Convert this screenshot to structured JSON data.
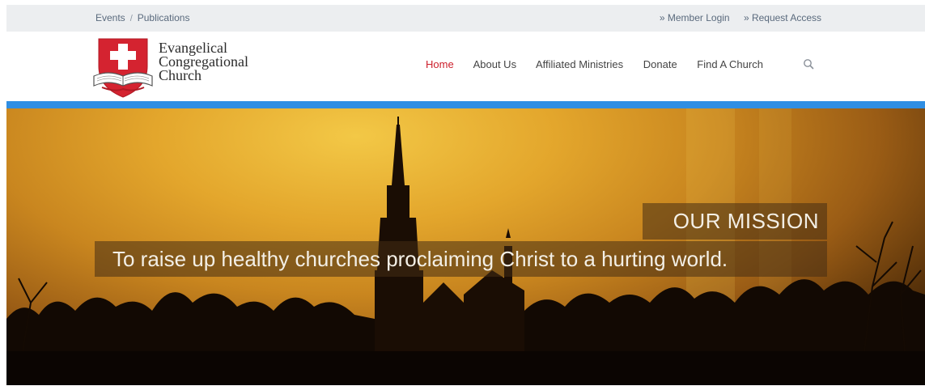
{
  "topbar": {
    "crumbs": [
      "Events",
      "Publications"
    ],
    "crumb_separator": "/",
    "member_login": "» Member Login",
    "request_access": "» Request Access"
  },
  "logo": {
    "line1": "Evangelical",
    "line2": "Congregational",
    "line3": "Church"
  },
  "nav": {
    "items": [
      {
        "label": "Home",
        "active": true
      },
      {
        "label": "About Us",
        "active": false
      },
      {
        "label": "Affiliated Ministries",
        "active": false
      },
      {
        "label": "Donate",
        "active": false
      },
      {
        "label": "Find A Church",
        "active": false
      }
    ],
    "search_icon": "search-icon"
  },
  "hero": {
    "label": "OUR MISSION",
    "statement": "To raise up healthy churches proclaiming Christ to a hurting world."
  },
  "colors": {
    "accent_blue": "#2f8ee3",
    "active_nav": "#cc1f2b",
    "logo_red": "#d42330"
  }
}
